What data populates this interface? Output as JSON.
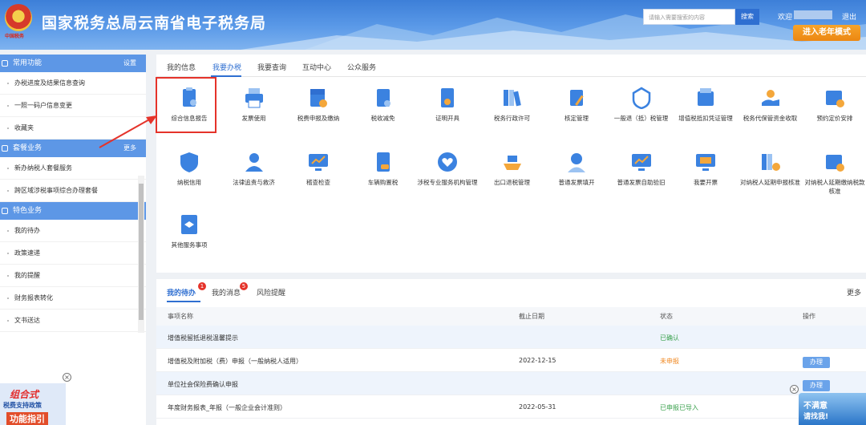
{
  "header": {
    "title": "国家税务总局云南省电子税务局",
    "emblem_text": "中国税务",
    "search_placeholder": "请输入需要搜索的内容",
    "search_label": "搜索",
    "welcome": "欢迎",
    "logout": "退出",
    "elder_mode": "进入老年模式"
  },
  "sidebar": {
    "sections": [
      {
        "title": "常用功能",
        "action": "设置",
        "items": [
          "办税进度及结果信息查询",
          "一照一码户信息变更",
          "收藏夹"
        ]
      },
      {
        "title": "套餐业务",
        "action": "更多",
        "items": [
          "新办纳税人套餐服务",
          "跨区域涉税事项综合办理套餐"
        ]
      },
      {
        "title": "特色业务",
        "action": "",
        "items": [
          "我的待办",
          "政策速递",
          "我的提醒",
          "财务报表转化",
          "文书送达"
        ]
      }
    ],
    "promo": {
      "line1": "组合式",
      "line2": "税费支持政策",
      "line3": "功能指引"
    }
  },
  "main": {
    "tabs": [
      "我的信息",
      "我要办税",
      "我要查询",
      "互动中心",
      "公众服务"
    ],
    "active_tab": "我要办税",
    "services": [
      {
        "label": "综合信息报告",
        "icon": "report-icon",
        "color": "#3b82e0"
      },
      {
        "label": "发票使用",
        "icon": "printer-icon",
        "color": "#3b82e0"
      },
      {
        "label": "税费申报及缴纳",
        "icon": "declare-icon",
        "color": "#3b82e0"
      },
      {
        "label": "税收减免",
        "icon": "tax-relief-icon",
        "color": "#3b82e0"
      },
      {
        "label": "证明开具",
        "icon": "certificate-icon",
        "color": "#3b82e0"
      },
      {
        "label": "税务行政许可",
        "icon": "binders-icon",
        "color": "#3b82e0"
      },
      {
        "label": "核定管理",
        "icon": "clipboard-edit-icon",
        "color": "#3b82e0"
      },
      {
        "label": "一般退（抵）税管理",
        "icon": "refund-shield-icon",
        "color": "#3b82e0"
      },
      {
        "label": "增值税抵扣凭证管理",
        "icon": "voucher-icon",
        "color": "#3b82e0"
      },
      {
        "label": "税务代保管资金收取",
        "icon": "hand-coin-icon",
        "color": "#3b82e0"
      },
      {
        "label": "预约定价安排",
        "icon": "calendar-clock-icon",
        "color": "#3b82e0"
      },
      {
        "label": "纳税信用",
        "icon": "credit-shield-icon",
        "color": "#3b82e0"
      },
      {
        "label": "法律追责与救济",
        "icon": "person-icon",
        "color": "#3b82e0"
      },
      {
        "label": "稽查检查",
        "icon": "monitor-chart-icon",
        "color": "#3b82e0"
      },
      {
        "label": "车辆购置税",
        "icon": "car-doc-icon",
        "color": "#3b82e0"
      },
      {
        "label": "涉税专业服务机构管理",
        "icon": "heart-circle-icon",
        "color": "#3b82e0"
      },
      {
        "label": "出口退税管理",
        "icon": "ship-icon",
        "color": "#3b82e0"
      },
      {
        "label": "普通发票填开",
        "icon": "agent-icon",
        "color": "#3b82e0"
      },
      {
        "label": "普通发票自助验旧",
        "icon": "monitor-chart-icon",
        "color": "#3b82e0"
      },
      {
        "label": "我要开票",
        "icon": "invoice-screen-icon",
        "color": "#3b82e0"
      },
      {
        "label": "对纳税人延期申报核准",
        "icon": "binders-clock-icon",
        "color": "#3b82e0"
      },
      {
        "label": "对纳税人延期缴纳税款核准",
        "icon": "calendar-clock-icon",
        "color": "#3b82e0"
      },
      {
        "label": "其他服务事项",
        "icon": "layers-doc-icon",
        "color": "#3b82e0"
      }
    ]
  },
  "todo": {
    "tabs": [
      {
        "label": "我的待办",
        "badge": "1"
      },
      {
        "label": "我的消息",
        "badge": "5"
      },
      {
        "label": "风险提醒",
        "badge": ""
      }
    ],
    "more": "更多",
    "columns": [
      "事项名称",
      "截止日期",
      "状态",
      "操作"
    ],
    "rows": [
      {
        "name": "增值税留抵退税温馨提示",
        "date": "",
        "status": "已确认",
        "status_type": "done",
        "action": ""
      },
      {
        "name": "增值税及附加税（费）申报（一般纳税人适用）",
        "date": "2022-12-15",
        "status": "未申报",
        "status_type": "todo",
        "action": "办理"
      },
      {
        "name": "单位社会保险费确认申报",
        "date": "",
        "status": "",
        "status_type": "",
        "action": "办理"
      },
      {
        "name": "年度财务报表_年报（一般企业会计准则）",
        "date": "2022-05-31",
        "status": "已申报已导入",
        "status_type": "done",
        "action": ""
      }
    ]
  },
  "float_banner": {
    "line1": "不满意",
    "line2": "请找我!"
  },
  "colors": {
    "accent": "#2f6fd1",
    "sidebar_head": "#5d97e6",
    "highlight": "#e5332a",
    "elder_btn": "#ec8712"
  }
}
